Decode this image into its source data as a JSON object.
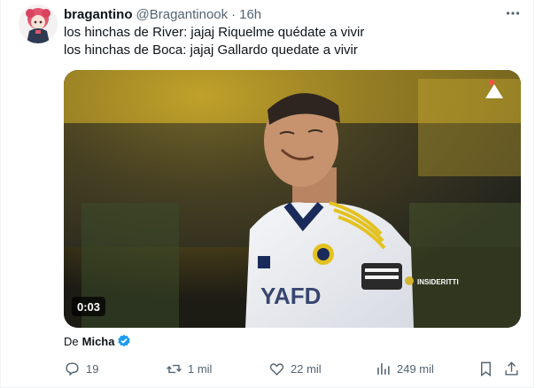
{
  "tweet": {
    "display_name": "bragantino",
    "handle": "@Bragantinook",
    "separator": "·",
    "time": "16h",
    "text_lines": [
      "los hinchas de River: jajaj Riquelme quédate a vivir",
      "los hinchas de Boca: jajaj Gallardo quedate a vivir"
    ]
  },
  "media": {
    "duration": "0:03",
    "watermark": "INSIDERITTI",
    "jersey_text": "YAFD"
  },
  "attribution": {
    "prefix": "De",
    "name": "Micha"
  },
  "actions": {
    "replies": "19",
    "reposts": "1 mil",
    "likes": "22 mil",
    "views": "249 mil"
  },
  "colors": {
    "text": "#0f1419",
    "muted": "#536471",
    "verified": "#1d9bf0",
    "accent": "#1d9bf0"
  },
  "icons": [
    "more-icon",
    "reply-icon",
    "repost-icon",
    "like-icon",
    "views-icon",
    "bookmark-icon",
    "share-icon",
    "verified-badge-icon"
  ]
}
